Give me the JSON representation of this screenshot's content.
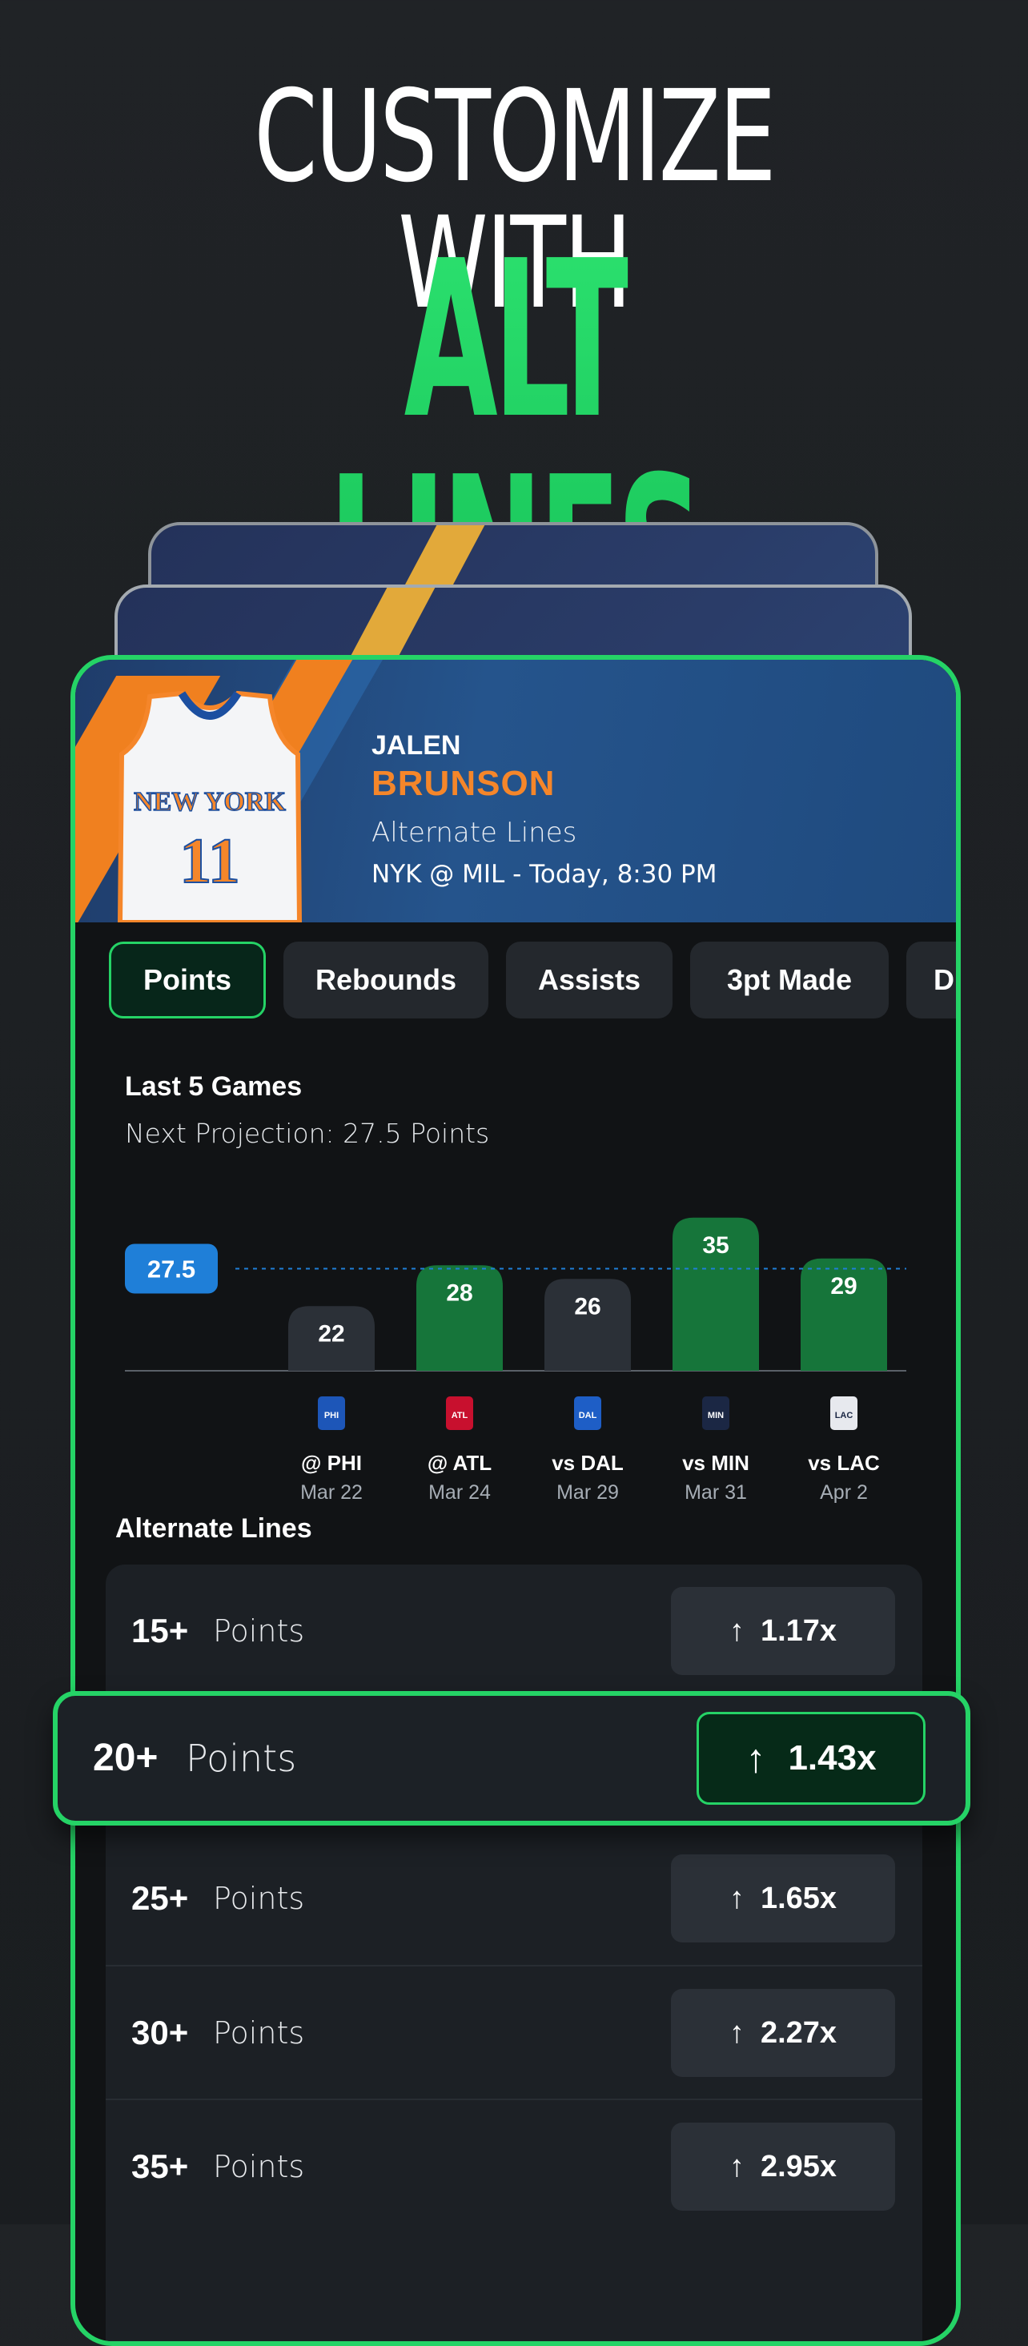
{
  "hero": {
    "line1": "CUSTOMIZE WITH",
    "line2": "ALT LINES"
  },
  "player": {
    "first_name": "JALEN",
    "last_name": "BRUNSON",
    "subtitle": "Alternate Lines",
    "matchup": "NYK @ MIL - Today, 8:30 PM",
    "jersey_team": "NEW YORK",
    "jersey_number": "11"
  },
  "tabs": [
    {
      "label": "Points",
      "active": true
    },
    {
      "label": "Rebounds",
      "active": false
    },
    {
      "label": "Assists",
      "active": false
    },
    {
      "label": "3pt Made",
      "active": false
    },
    {
      "label": "D",
      "active": false
    }
  ],
  "last5": {
    "title": "Last 5 Games",
    "projection_text": "Next Projection: 27.5 Points"
  },
  "chart_data": {
    "type": "bar",
    "projection": 27.5,
    "projection_label": "27.5",
    "games": [
      {
        "opponent": "@ PHI",
        "date": "Mar 22",
        "team_abbr": "PHI",
        "value": 22,
        "over": false
      },
      {
        "opponent": "@ ATL",
        "date": "Mar 24",
        "team_abbr": "ATL",
        "value": 28,
        "over": true
      },
      {
        "opponent": "vs DAL",
        "date": "Mar 29",
        "team_abbr": "DAL",
        "value": 26,
        "over": false
      },
      {
        "opponent": "vs MIN",
        "date": "Mar 31",
        "team_abbr": "MIN",
        "value": 35,
        "over": true
      },
      {
        "opponent": "vs LAC",
        "date": "Apr 2",
        "team_abbr": "LAC",
        "value": 29,
        "over": true
      }
    ],
    "colors": {
      "over": "#16753a",
      "under": "#2b3037",
      "projection": "#1f7fd8"
    }
  },
  "alt_lines": {
    "title": "Alternate Lines",
    "rows": [
      {
        "line": "15+",
        "stat": "Points",
        "multiplier": "1.17x"
      },
      {
        "line": "20+",
        "stat": "Points",
        "multiplier": "1.43x",
        "highlighted": true
      },
      {
        "line": "25+",
        "stat": "Points",
        "multiplier": "1.65x"
      },
      {
        "line": "30+",
        "stat": "Points",
        "multiplier": "2.27x"
      },
      {
        "line": "35+",
        "stat": "Points",
        "multiplier": "2.95x"
      }
    ]
  },
  "colors": {
    "accent": "#25d366",
    "player_last_name": "#f5862a",
    "background": "#1e2124"
  }
}
